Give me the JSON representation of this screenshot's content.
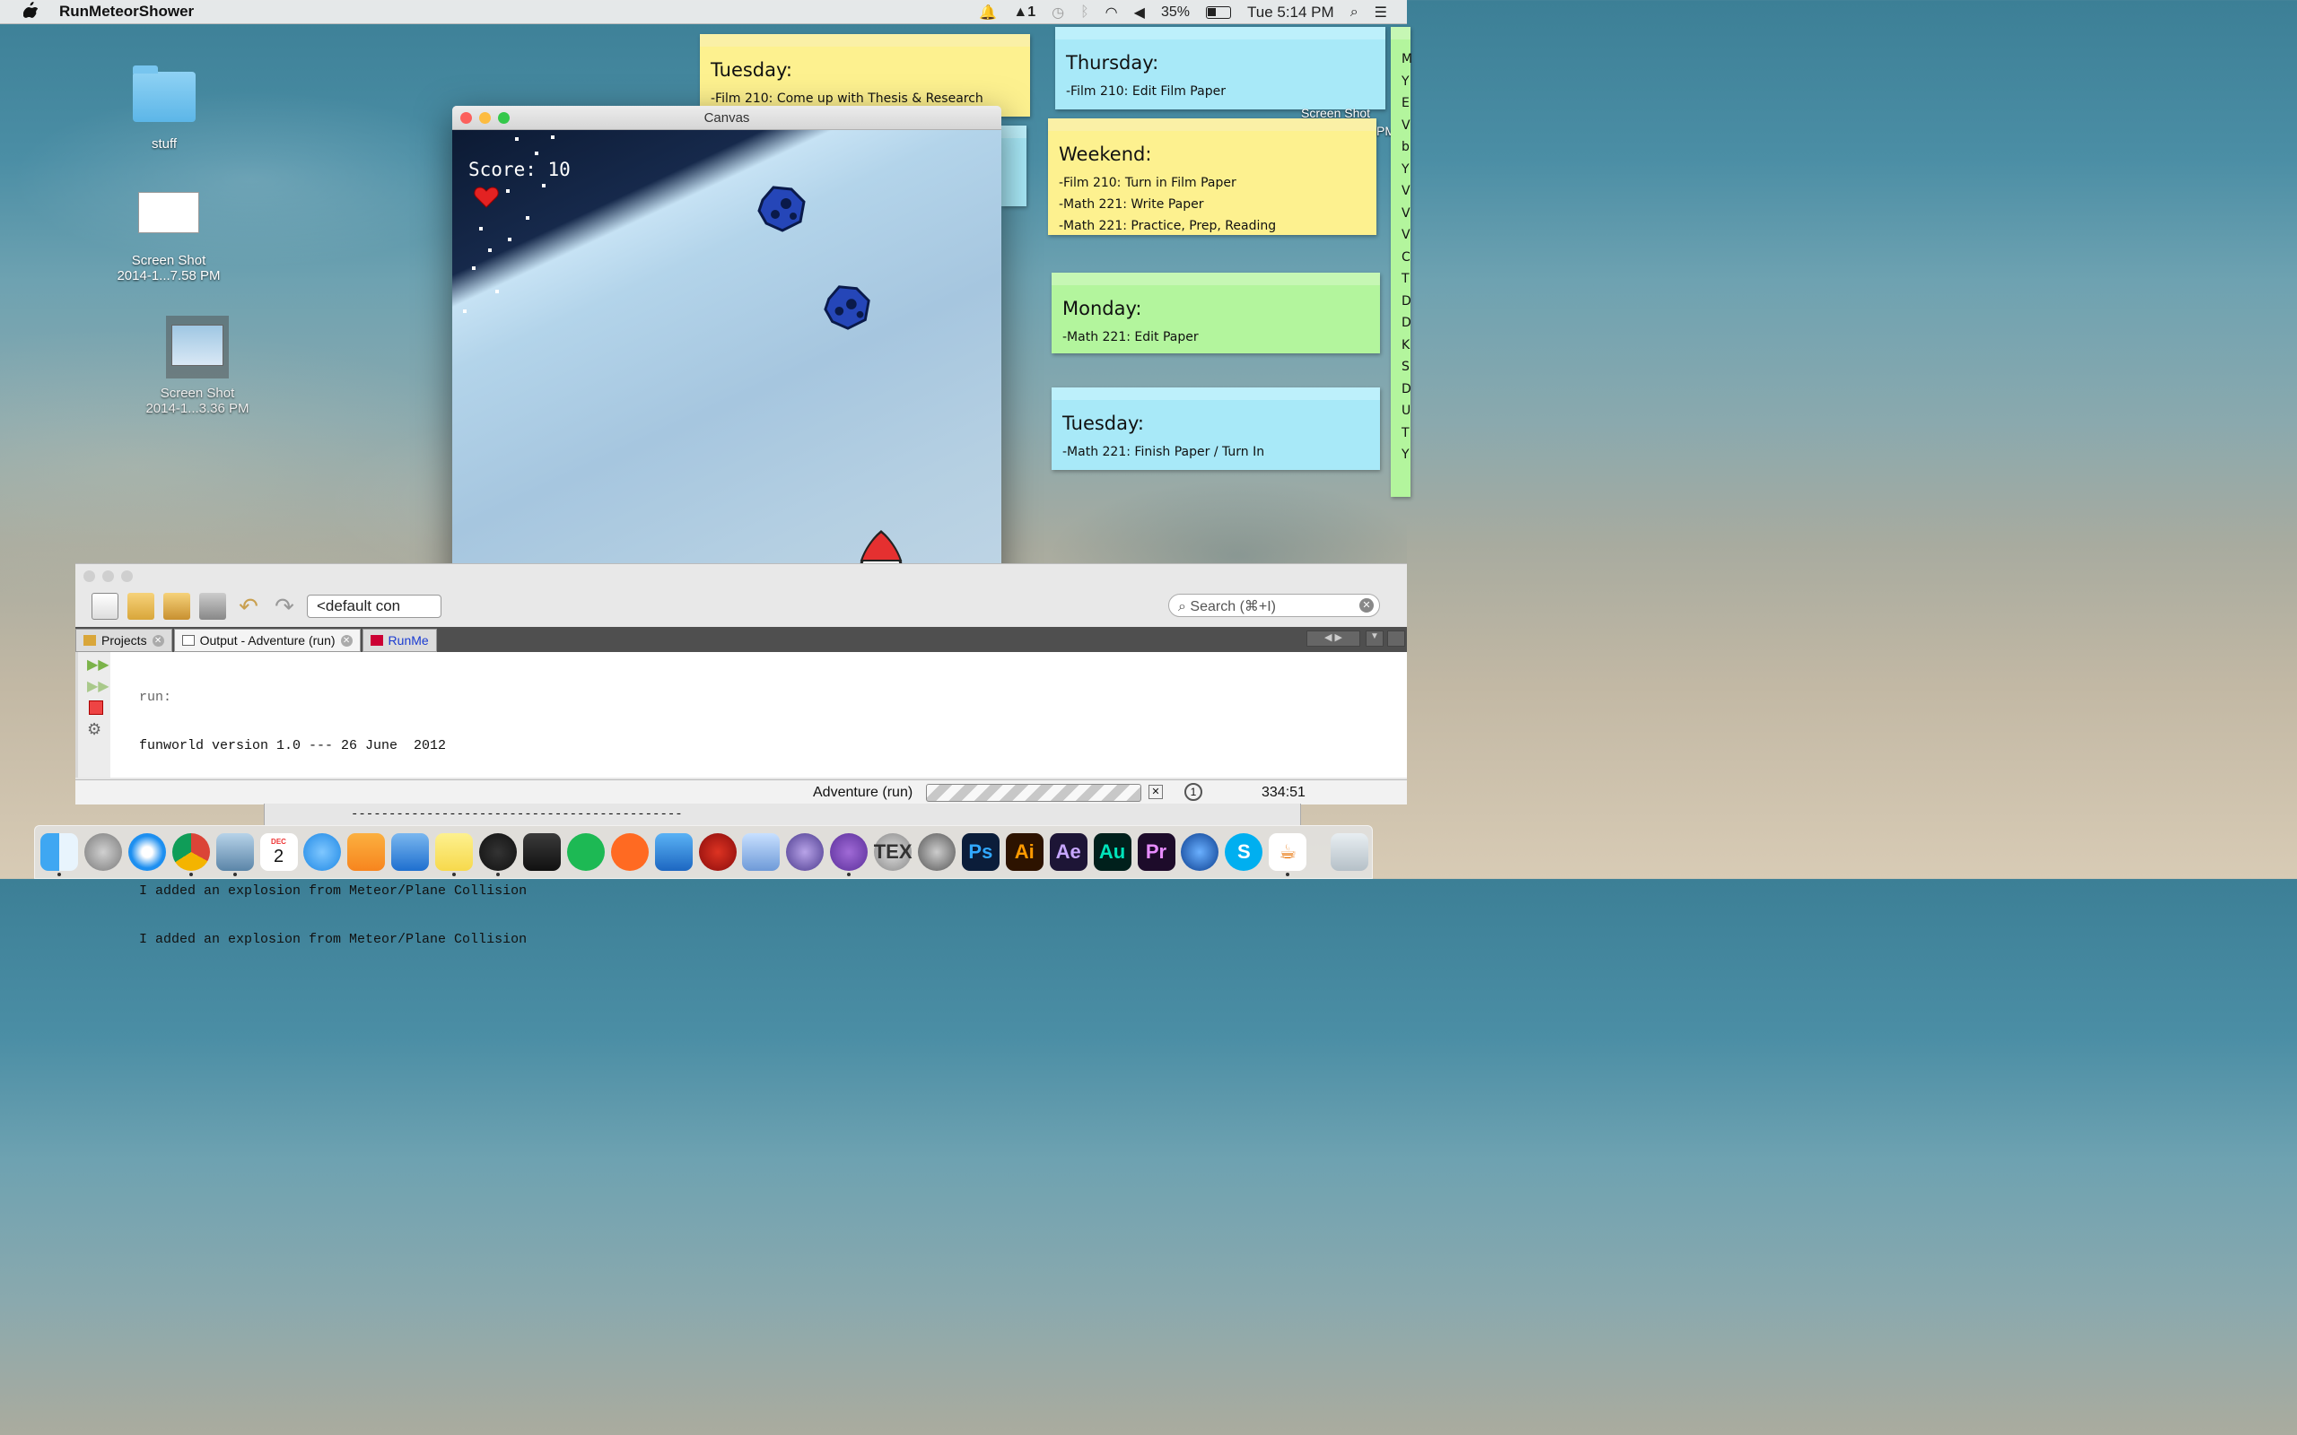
{
  "menubar": {
    "app_name": "RunMeteorShower",
    "battery": "35%",
    "clock": "Tue 5:14 PM",
    "adobe_count": "1"
  },
  "desktop": {
    "icons": [
      {
        "label": "stuff"
      },
      {
        "label1": "Screen Shot",
        "label2": "2014-1...7.58 PM"
      },
      {
        "label1": "Screen Shot",
        "label2": "2014-1...3.36 PM"
      }
    ],
    "partial_label_1": "Screen Shot",
    "partial_label_2": "PM"
  },
  "stickies": [
    {
      "heading": "Tuesday:",
      "lines": [
        "-Film 210: Come up with Thesis & Research"
      ]
    },
    {
      "heading": "Thursday:",
      "lines": [
        "-Film 210: Edit Film Paper"
      ]
    },
    {
      "heading": "Weekend:",
      "lines": [
        "-Film 210: Turn in Film Paper",
        "-Math 221: Write Paper",
        "-Math 221: Practice, Prep, Reading"
      ]
    },
    {
      "heading": "Monday:",
      "lines": [
        "-Math 221: Edit Paper"
      ]
    },
    {
      "heading": "Tuesday:",
      "lines": [
        "-Math 221: Finish Paper / Turn In"
      ]
    }
  ],
  "edge_sticky_letters": [
    "M",
    "Y",
    "E",
    "V",
    "b",
    "Y",
    "V",
    "V",
    "V",
    "C",
    "T",
    "D",
    "D",
    "K",
    "S",
    "D",
    "U",
    "T",
    "Y"
  ],
  "canvas": {
    "title": "Canvas",
    "score_text": "Score: 10"
  },
  "ide": {
    "config_combo": "<default con",
    "search_placeholder": "Search (⌘+I)",
    "tabs": [
      "Projects",
      "Output - Adventure (run)",
      "RunMe"
    ],
    "output_lines": [
      "run:",
      "funworld version 1.0 --- 26 June  2012",
      "--------------------------------------------",
      "",
      "I added an explosion from Meteor/Plane Collision",
      "I added an explosion from Meteor/Plane Collision"
    ],
    "status_task": "Adventure (run)",
    "cursor_pos": "334:51",
    "bottom_dashes": "--------------------------------------------"
  },
  "dock": {
    "icons": [
      "finder-icon",
      "launchpad-icon",
      "safari-icon",
      "chrome-icon",
      "preview-icon",
      "calendar-icon",
      "messages-icon",
      "pages-icon",
      "keynote-icon",
      "stickies-icon",
      "activity-monitor-icon",
      "photo-booth-icon",
      "spotify-icon",
      "soundcloud-icon",
      "xcode-icon",
      "textmate-icon",
      "cube-icon",
      "eclipse-icon",
      "github-icon",
      "tex-icon",
      "system-prefs-icon",
      "photoshop-icon",
      "illustrator-icon",
      "after-effects-icon",
      "audition-icon",
      "premiere-icon",
      "quicktime-icon",
      "skype-icon",
      "java-icon",
      "trash-icon"
    ],
    "calendar_month": "DEC",
    "calendar_day": "2",
    "ps": "Ps",
    "ai": "Ai",
    "ae": "Ae",
    "au": "Au",
    "pr": "Pr",
    "tex": "TEX"
  }
}
